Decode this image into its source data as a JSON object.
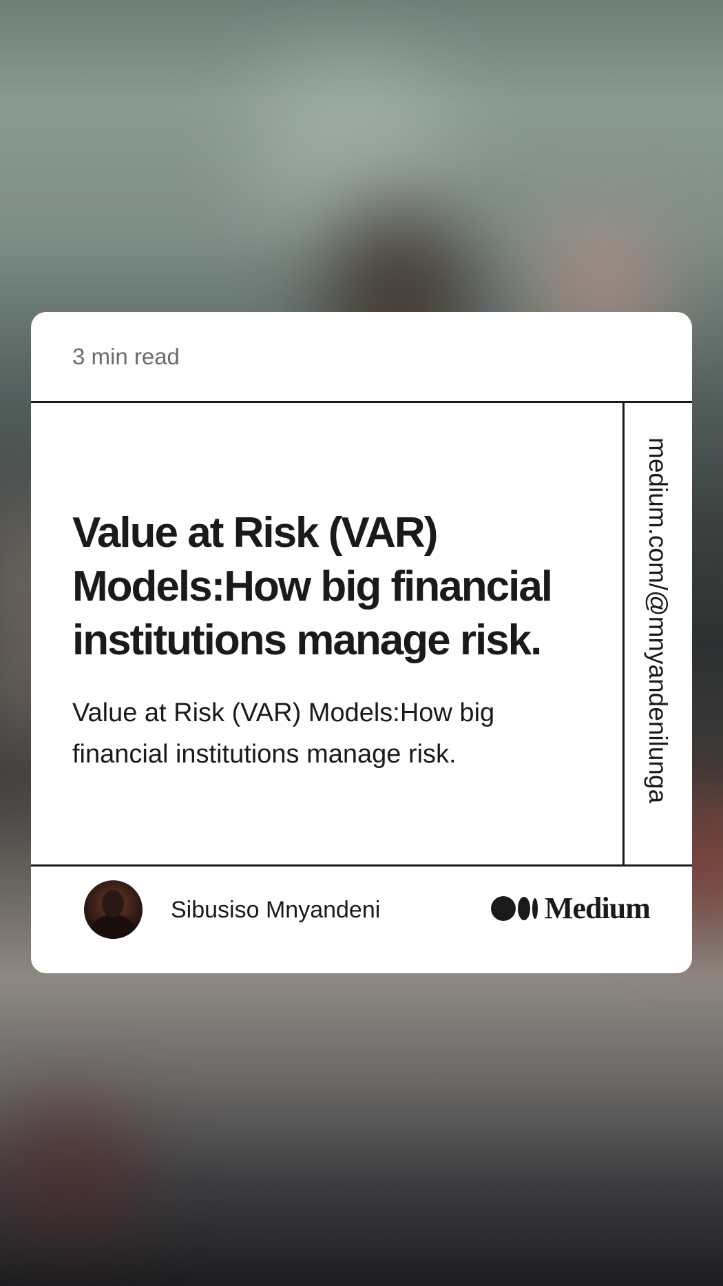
{
  "card": {
    "read_time": "3 min read",
    "title": "Value at Risk (VAR) Models:How big financial institutions manage risk.",
    "subtitle": "Value at Risk (VAR) Models:How big financial institutions manage risk.",
    "profile_url": "medium.com/@mnyandenilunga",
    "author_name": "Sibusiso Mnyandeni",
    "brand_name": "Medium"
  },
  "icons": {
    "avatar": "author-avatar",
    "logo": "medium-logo-icon"
  },
  "colors": {
    "card_background": "#ffffff",
    "text_primary": "#1a1a1a",
    "text_secondary": "#6b6b6b"
  }
}
